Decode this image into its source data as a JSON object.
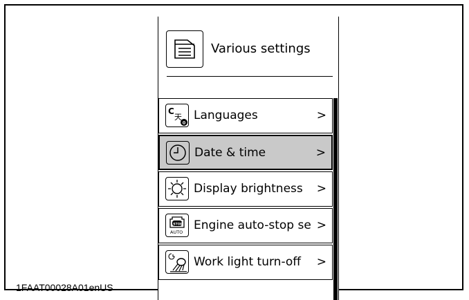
{
  "header": {
    "title": "Various settings",
    "icon": "document-icon"
  },
  "menu": {
    "items": [
      {
        "label": "Languages",
        "chevron": ">",
        "icon": "language-icon",
        "selected": false
      },
      {
        "label": "Date & time",
        "chevron": ">",
        "icon": "clock-icon",
        "selected": true
      },
      {
        "label": "Display brightness",
        "chevron": ">",
        "icon": "brightness-icon",
        "selected": false
      },
      {
        "label": "Engine auto-stop se",
        "chevron": ">",
        "icon": "engine-auto-stop-icon",
        "selected": false
      },
      {
        "label": "Work light turn-off",
        "chevron": ">",
        "icon": "work-light-icon",
        "selected": false
      }
    ],
    "icon_texts": {
      "language_c": "C",
      "language_char": "天",
      "language_phi": "Φ",
      "stop": "STOP",
      "auto": "AUTO"
    }
  },
  "figure_code": "1FAAT00028A01enUS",
  "colors": {
    "selected_background": "#c9c9c9",
    "border": "#000000",
    "background": "#ffffff"
  }
}
